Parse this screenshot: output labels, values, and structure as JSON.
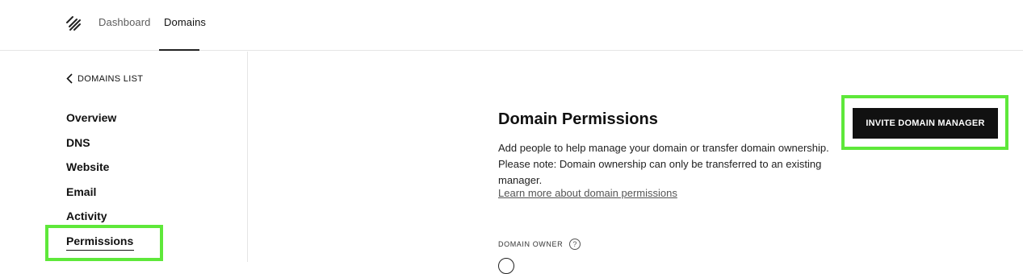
{
  "header": {
    "nav": {
      "dashboard": "Dashboard",
      "domains": "Domains"
    }
  },
  "sidebar": {
    "back_label": "DOMAINS LIST",
    "items": [
      "Overview",
      "DNS",
      "Website",
      "Email",
      "Activity",
      "Permissions"
    ],
    "active_item": "Permissions"
  },
  "main": {
    "title": "Domain Permissions",
    "description": "Add people to help manage your domain or transfer domain ownership. Please note: Domain ownership can only be transferred to an existing manager.",
    "learn_more": "Learn more about domain permissions",
    "owner_label": "DOMAIN OWNER",
    "help_icon_glyph": "?",
    "invite_button": "INVITE DOMAIN MANAGER"
  },
  "colors": {
    "highlight": "#5ee83a",
    "button_bg": "#111111",
    "divider": "#e5e5e5"
  },
  "icons": [
    "squarespace-logo-icon",
    "chevron-left-icon",
    "help-icon"
  ]
}
